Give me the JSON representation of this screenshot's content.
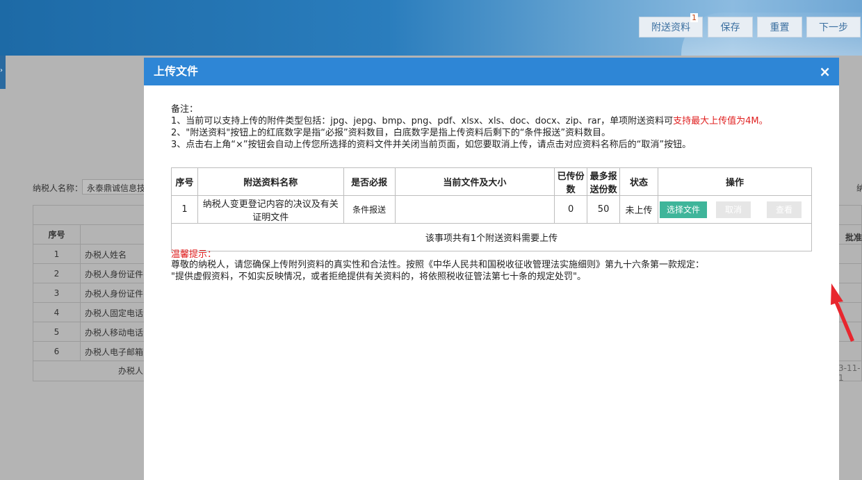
{
  "header": {
    "buttons": [
      {
        "label": "附送资料",
        "badge": "1"
      },
      {
        "label": "保存"
      },
      {
        "label": "重置"
      },
      {
        "label": "下一步"
      }
    ]
  },
  "background": {
    "side_tab_glyph": "›",
    "taxpayer_label": "纳税人名称：",
    "taxpayer_value": "永泰鼎诚信息技",
    "right_label": "纳",
    "table_head_index": "序号",
    "rows": [
      {
        "index": "1",
        "label": "办税人姓名"
      },
      {
        "index": "2",
        "label": "办税人身份证件"
      },
      {
        "index": "3",
        "label": "办税人身份证件"
      },
      {
        "index": "4",
        "label": "办税人固定电话"
      },
      {
        "index": "5",
        "label": "办税人移动电话"
      },
      {
        "index": "6",
        "label": "办税人电子邮箱"
      }
    ],
    "footer": "办税人",
    "approve_label": "批准",
    "date_fragment": "3-11-1"
  },
  "modal": {
    "title": "上传文件",
    "close": "×",
    "notes": {
      "heading": "备注：",
      "line1_prefix": "1、当前可以支持上传的附件类型包括：jpg、jepg、bmp、png、pdf、xlsx、xls、doc、docx、zip、rar，单项附送资料可",
      "line1_red": "支持最大上传值为4M。",
      "line2": "2、\"附送资料\"按钮上的红底数字是指“必报”资料数目，白底数字是指上传资料后剩下的“条件报送”资料数目。",
      "line3": "3、点击右上角“×”按钮会自动上传您所选择的资料文件并关闭当前页面，如您要取消上传，请点击对应资料名称后的“取消”按钮。"
    },
    "table": {
      "headers": [
        "序号",
        "附送资料名称",
        "是否必报",
        "当前文件及大小",
        "已传份数",
        "最多报送份数",
        "状态",
        "操作"
      ],
      "rows": [
        {
          "index": "1",
          "name": "纳税人变更登记内容的决议及有关证明文件",
          "required": "条件报送",
          "file": "",
          "uploaded": "0",
          "max": "50",
          "status": "未上传",
          "actions": {
            "choose": "选择文件",
            "cancel": "取消",
            "view": "查看"
          }
        }
      ],
      "summary": "该事项共有1个附送资料需要上传"
    },
    "tips": {
      "title": "温馨提示：",
      "line1": "尊敬的纳税人，请您确保上传附列资料的真实性和合法性。按照《中华人民共和国税收征收管理法实施细则》第九十六条第一款规定：",
      "line2": "\"提供虚假资料，不如实反映情况，或者拒绝提供有关资料的，将依照税收征管法第七十条的规定处罚\"。"
    }
  },
  "colors": {
    "header_blue": "#2e86d6",
    "choose_green": "#3fb59a",
    "warning_red": "#e02020",
    "arrow_red": "#e8262e"
  }
}
